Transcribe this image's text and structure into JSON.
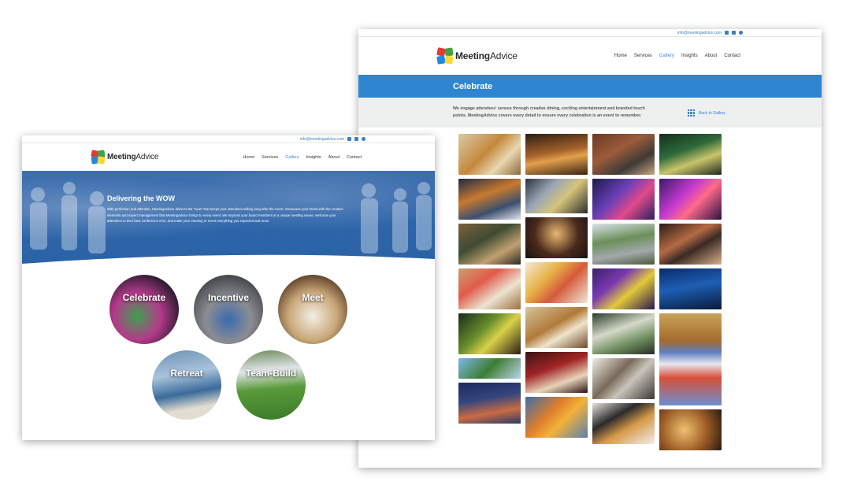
{
  "back_page": {
    "email": "info@meetingadvice.com",
    "brand_bold": "Meeting",
    "brand_light": "Advice",
    "nav": [
      "Home",
      "Services",
      "Gallery",
      "Insights",
      "About",
      "Contact"
    ],
    "active_nav": "Gallery",
    "banner_title": "Celebrate",
    "intro": "We engage attendees' senses through creative dining, exciting entertainment and branded touch points.  MeetingAdvice covers every detail to ensure every celebration is an event to remember.",
    "back_link": "Back to Gallery"
  },
  "front_page": {
    "email": "info@meetingadvice.com",
    "brand_bold": "Meeting",
    "brand_light": "Advice",
    "nav": [
      "Home",
      "Services",
      "Gallery",
      "Insights",
      "About",
      "Contact"
    ],
    "active_nav": "Gallery",
    "hero_title_prefix": "Delivering the ",
    "hero_title_em": "WOW",
    "hero_body": "With perfection and attention, MeetingAdvice delivers the \"wow\" that keeps your attendees talking long after the event. Showcase your brand with the creative elements and expert management that MeetingAdvice brings to every event. We impress your board members at a unique meeting venue, welcome your attendees to their best conference ever, and make your meeting or event everything you expected and more.",
    "categories": [
      "Celebrate",
      "Incentive",
      "Meet",
      "Retreat",
      "Team-Build"
    ]
  },
  "colors": {
    "accent": "#2e86d1",
    "hero": "#2f66aa",
    "grey_band": "#eeefef"
  }
}
